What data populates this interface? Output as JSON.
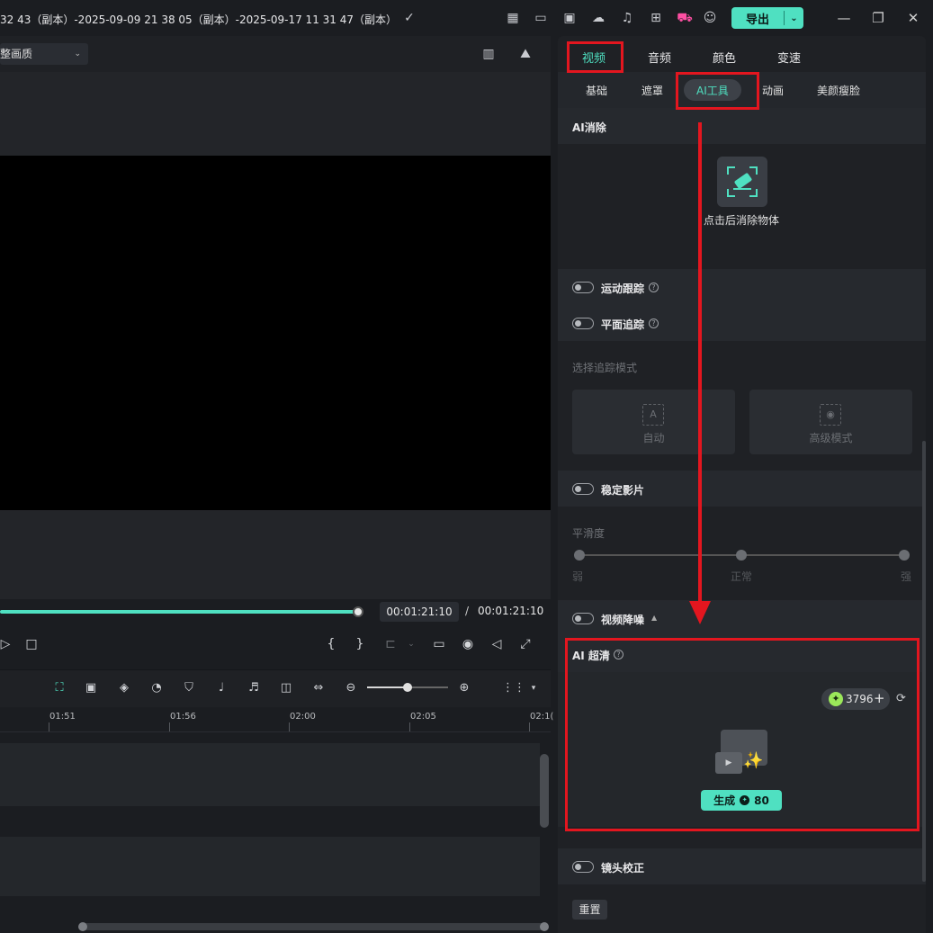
{
  "titlebar": {
    "title": "32 43（副本）-2025-09-09 21 38 05（副本）-2025-09-17 11 31 47（副本）",
    "export_label": "导出"
  },
  "preview": {
    "quality_label": "整画质",
    "timecode_current": "00:01:21:10",
    "timecode_separator": "/",
    "timecode_total": "00:01:21:10",
    "progress": 1.0
  },
  "timeline": {
    "ruler_labels": [
      "01:51",
      "01:56",
      "02:00",
      "02:05",
      "02:1("
    ]
  },
  "right_panel": {
    "main_tabs": [
      "视频",
      "音频",
      "颜色",
      "变速"
    ],
    "sub_tabs": [
      "基础",
      "遮罩",
      "AI工具",
      "动画",
      "美颜瘦脸"
    ],
    "ai_erase": {
      "title": "AI消除",
      "action_label": "点击后消除物体"
    },
    "motion_tracking": {
      "label": "运动跟踪"
    },
    "planar_tracking": {
      "label": "平面追踪"
    },
    "track_mode": {
      "label": "选择追踪模式",
      "auto": "自动",
      "advanced": "高级模式"
    },
    "stabilize": {
      "label": "稳定影片"
    },
    "smoothness": {
      "label": "平滑度",
      "weak": "弱",
      "normal": "正常",
      "strong": "强"
    },
    "denoise": {
      "label": "视频降噪"
    },
    "ai_super": {
      "title": "AI 超清",
      "credits": "3796",
      "generate_label": "生成",
      "generate_cost": "80"
    },
    "lens_correction": {
      "label": "镜头校正"
    },
    "reset_label": "重置"
  },
  "colors": {
    "accent": "#4fe0c1",
    "annotation": "#e3161f"
  }
}
